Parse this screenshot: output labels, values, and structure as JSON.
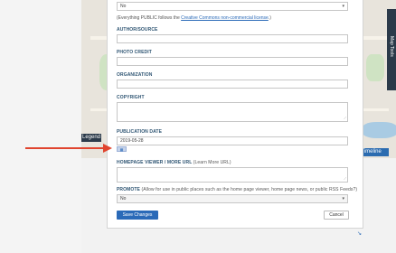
{
  "background": {
    "legend_label": "Legend",
    "timeline_label": "t Timeline",
    "map_tools_label": "Map Tools"
  },
  "form": {
    "top_select": {
      "value": "No"
    },
    "license_note": {
      "prefix": "(Everything PUBLIC follows the ",
      "link": "Creative Commons non-commercial license",
      "suffix": ".)"
    },
    "author": {
      "label": "AUTHOR/SOURCE",
      "value": ""
    },
    "photo_credit": {
      "label": "PHOTO CREDIT",
      "value": ""
    },
    "organization": {
      "label": "ORGANIZATION",
      "value": ""
    },
    "copyright": {
      "label": "COPYRIGHT",
      "value": ""
    },
    "publication_date": {
      "label": "PUBLICATION DATE",
      "value": "2019-05-28"
    },
    "homepage_viewer": {
      "label": "HOMEPAGE VIEWER / MORE URL",
      "sublabel": "(Learn More URL)",
      "value": ""
    },
    "promote": {
      "label": "PROMOTE",
      "sublabel": "(Allow for use in public places such as the home page viewer, home page news, or public RSS Feeds?)",
      "value": "No"
    },
    "save_label": "Save Changes",
    "cancel_label": "Cancel"
  },
  "colors": {
    "accent": "#2a6ab8",
    "label": "#2f5573",
    "annotation_arrow": "#e0442e"
  }
}
